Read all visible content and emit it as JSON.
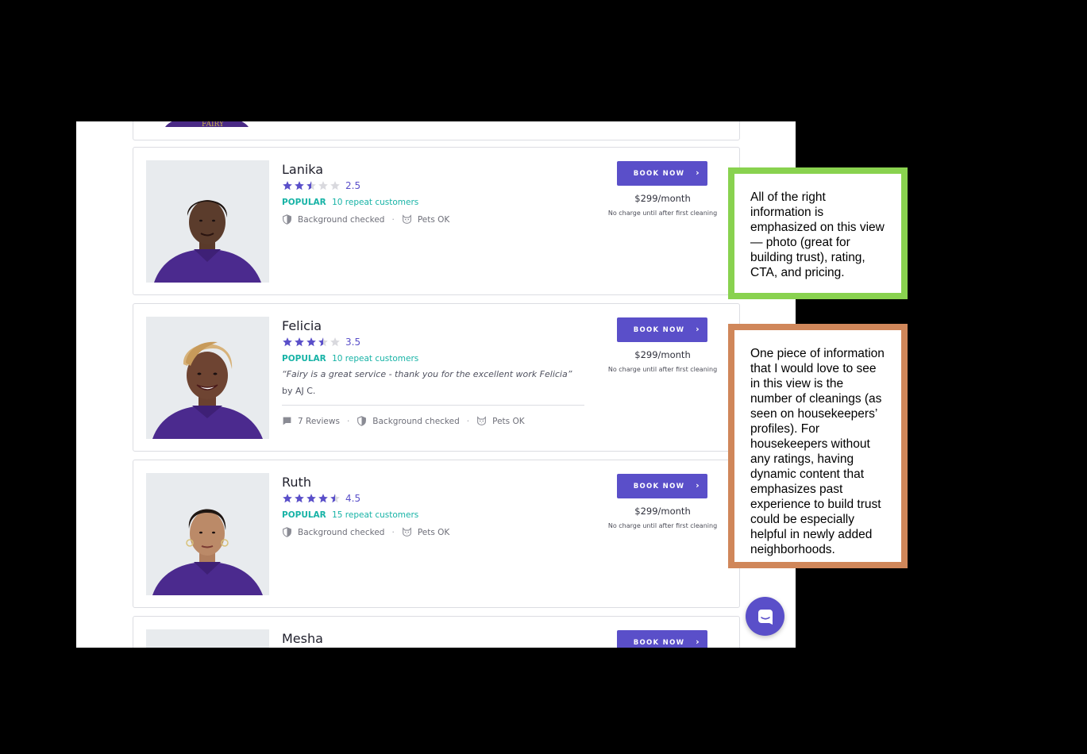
{
  "cards": [
    {
      "name": "Lanika",
      "rating": "2.5",
      "popular": "POPULAR",
      "repeat": "10 repeat customers",
      "book": "BOOK NOW",
      "price": "$299/month",
      "note": "No charge until after first cleaning",
      "badges": {
        "bg": "Background checked",
        "pets": "Pets OK"
      }
    },
    {
      "name": "Felicia",
      "rating": "3.5",
      "popular": "POPULAR",
      "repeat": "10 repeat customers",
      "quote": "“Fairy is a great service - thank you for the excellent work Felicia”",
      "quote_by": "by AJ C.",
      "book": "BOOK NOW",
      "price": "$299/month",
      "note": "No charge until after first cleaning",
      "badges": {
        "reviews": "7 Reviews",
        "bg": "Background checked",
        "pets": "Pets OK"
      }
    },
    {
      "name": "Ruth",
      "rating": "4.5",
      "popular": "POPULAR",
      "repeat": "15 repeat customers",
      "book": "BOOK NOW",
      "price": "$299/month",
      "note": "No charge until after first cleaning",
      "badges": {
        "bg": "Background checked",
        "pets": "Pets OK"
      }
    },
    {
      "name": "Mesha",
      "book": "BOOK NOW"
    }
  ],
  "annotations": {
    "green": "All of the right information is emphasized on this view — photo (great for building trust), rating, CTA, and pricing.",
    "orange": "One piece of information that I would love to see in this view is the number of cleanings (as seen on housekeepers’ profiles). For housekeepers without any ratings, having dynamic content that emphasizes past experience to build trust could be especially helpful in newly added neighborhoods."
  },
  "colors": {
    "accent": "#5a4fc9",
    "teal": "#17b3a6",
    "green_note": "#89d24f",
    "orange_note": "#d0875a"
  },
  "icons": {
    "shield": "shield-icon",
    "cat": "cat-icon",
    "comment": "comment-icon",
    "chat": "chat-icon",
    "star": "star-icon",
    "chevron": "chevron-right-icon"
  }
}
